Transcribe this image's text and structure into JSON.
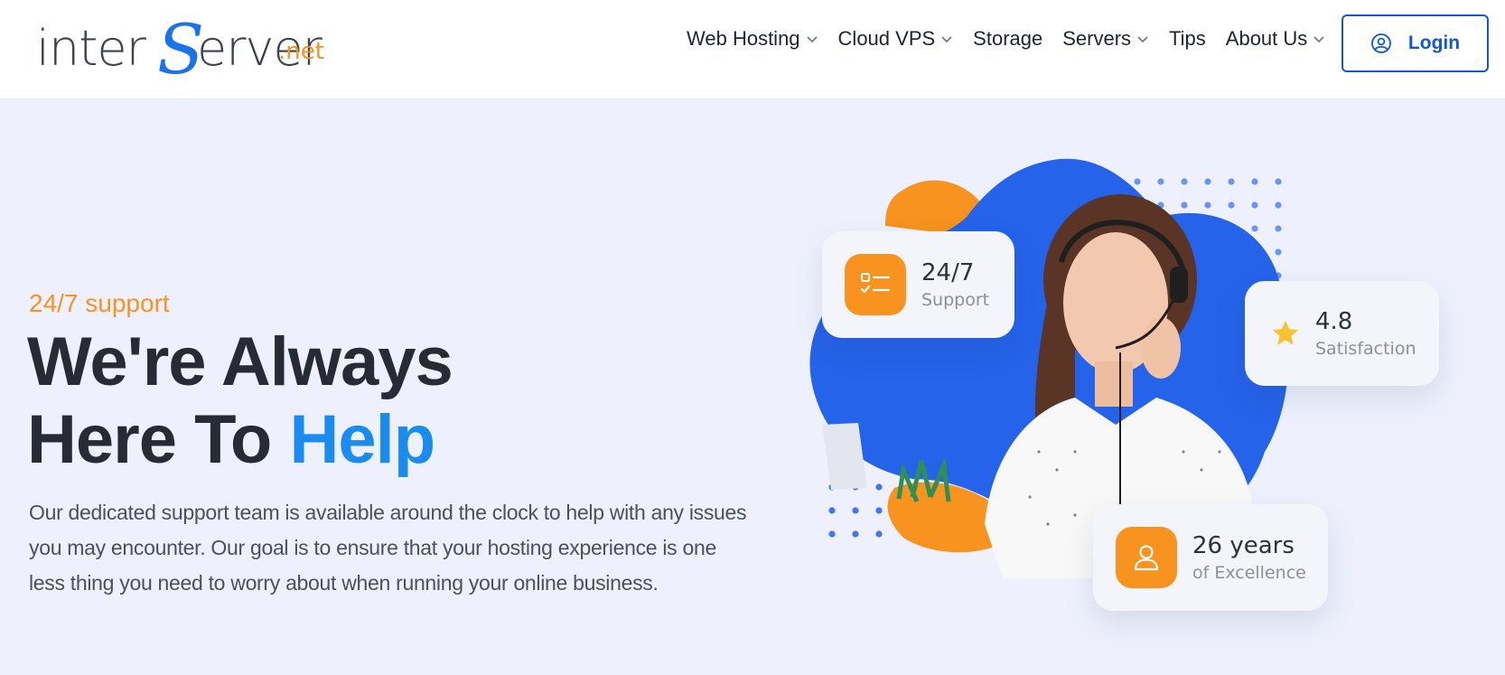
{
  "header": {
    "logo": {
      "inter": "inter",
      "s": "S",
      "erver": "erver",
      "net": ".net"
    },
    "nav": [
      {
        "label": "Web Hosting",
        "has_dropdown": true
      },
      {
        "label": "Cloud VPS",
        "has_dropdown": true
      },
      {
        "label": "Storage",
        "has_dropdown": false
      },
      {
        "label": "Servers",
        "has_dropdown": true
      },
      {
        "label": "Tips",
        "has_dropdown": false
      },
      {
        "label": "About Us",
        "has_dropdown": true
      }
    ],
    "login": {
      "label": "Login",
      "icon": "user-circle-icon"
    }
  },
  "hero": {
    "eyebrow": "24/7 support",
    "headline_line1": "We're Always",
    "headline_line2_plain": "Here To ",
    "headline_line2_accent": "Help",
    "description": "Our dedicated support team is available around the clock to help with any issues you may encounter. Our goal is to ensure that your hosting experience is one less thing you need to worry about when running your online business."
  },
  "cards": {
    "support": {
      "title": "24/7",
      "subtitle": "Support",
      "icon": "checklist-icon"
    },
    "rating": {
      "title": "4.8",
      "subtitle": "Satisfaction",
      "icon": "star-icon"
    },
    "years": {
      "title": "26 years",
      "subtitle": "of Excellence",
      "icon": "user-icon"
    }
  },
  "colors": {
    "accent_blue": "#1a8cf0",
    "brand_blue": "#1356d6",
    "orange": "#f7931e",
    "hero_bg": "#eef1fd",
    "blob_blue": "#2563eb"
  }
}
